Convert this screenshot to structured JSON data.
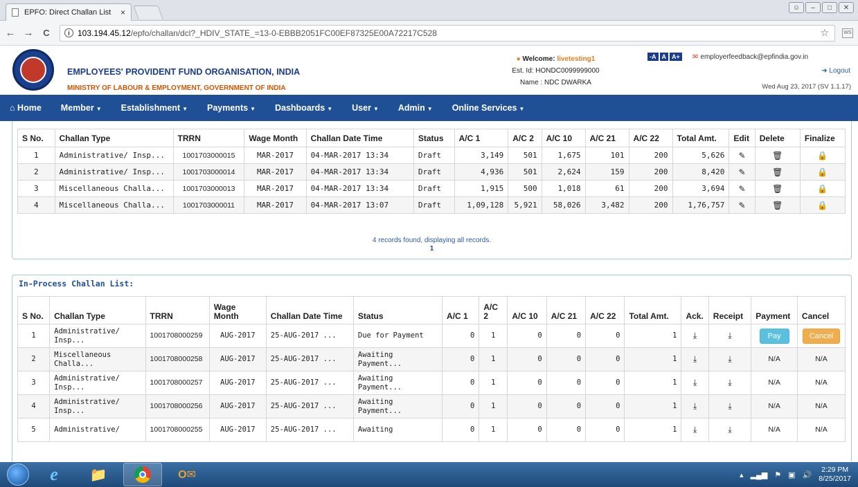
{
  "browser": {
    "tab_title": "EPFO: Direct Challan List",
    "tab_close": "×",
    "url_host": "103.194.45.12",
    "url_path": "/epfo/challan/dcl?_HDIV_STATE_=13-0-EBBB2051FC00EF87325E00A72217C528",
    "info_glyph": "i",
    "star_glyph": "☆",
    "back_glyph": "←",
    "forward_glyph": "→",
    "reload_glyph": "C"
  },
  "header": {
    "org_name": "EMPLOYEES' PROVIDENT FUND ORGANISATION, INDIA",
    "ministry": "MINISTRY OF LABOUR & EMPLOYMENT, GOVERNMENT OF INDIA",
    "welcome_label": "Welcome: ",
    "welcome_user": "livetesting1",
    "est_id": "Est. Id: HONDC0099999000",
    "name": "Name : NDC DWARKA",
    "font_small": "-A",
    "font_normal": "A",
    "font_large": "A+",
    "feedback_email": "employerfeedback@epfindia.gov.in",
    "logout": "Logout",
    "date": "Wed Aug 23, 2017 (SV 1.1.17)"
  },
  "menu": [
    {
      "label": "Home"
    },
    {
      "label": "Member"
    },
    {
      "label": "Establishment"
    },
    {
      "label": "Payments"
    },
    {
      "label": "Dashboards"
    },
    {
      "label": "User"
    },
    {
      "label": "Admin"
    },
    {
      "label": "Online Services"
    }
  ],
  "draft_table": {
    "headers": [
      "S No.",
      "Challan Type",
      "TRRN",
      "Wage Month",
      "Challan Date Time",
      "Status",
      "A/C 1",
      "A/C 2",
      "A/C 10",
      "A/C 21",
      "A/C 22",
      "Total Amt.",
      "Edit",
      "Delete",
      "Finalize"
    ],
    "rows": [
      [
        "1",
        "Administrative/ Insp...",
        "1001703000015",
        "MAR-2017",
        "04-MAR-2017 13:34",
        "Draft",
        "3,149",
        "501",
        "1,675",
        "101",
        "200",
        "5,626"
      ],
      [
        "2",
        "Administrative/ Insp...",
        "1001703000014",
        "MAR-2017",
        "04-MAR-2017 13:34",
        "Draft",
        "4,936",
        "501",
        "2,624",
        "159",
        "200",
        "8,420"
      ],
      [
        "3",
        "Miscellaneous Challa...",
        "1001703000013",
        "MAR-2017",
        "04-MAR-2017 13:34",
        "Draft",
        "1,915",
        "500",
        "1,018",
        "61",
        "200",
        "3,694"
      ],
      [
        "4",
        "Miscellaneous Challa...",
        "1001703000011",
        "MAR-2017",
        "04-MAR-2017 13:07",
        "Draft",
        "1,09,128",
        "5,921",
        "58,026",
        "3,482",
        "200",
        "1,76,757"
      ]
    ],
    "records_text": "4 records found, displaying all records.",
    "page": "1"
  },
  "inprocess": {
    "title": "In-Process Challan List:",
    "headers": [
      "S No.",
      "Challan Type",
      "TRRN",
      "Wage Month",
      "Challan Date Time",
      "Status",
      "A/C 1",
      "A/C 2",
      "A/C 10",
      "A/C 21",
      "A/C 22",
      "Total Amt.",
      "Ack.",
      "Receipt",
      "Payment",
      "Cancel"
    ],
    "rows": [
      [
        "1",
        "Administrative/ Insp...",
        "1001708000259",
        "AUG-2017",
        "25-AUG-2017 ...",
        "Due for Payment",
        "0",
        "1",
        "0",
        "0",
        "0",
        "1",
        "Pay",
        "Cancel"
      ],
      [
        "2",
        "Miscellaneous Challa...",
        "1001708000258",
        "AUG-2017",
        "25-AUG-2017 ...",
        "Awaiting Payment...",
        "0",
        "1",
        "0",
        "0",
        "0",
        "1",
        "N/A",
        "N/A"
      ],
      [
        "3",
        "Administrative/ Insp...",
        "1001708000257",
        "AUG-2017",
        "25-AUG-2017 ...",
        "Awaiting Payment...",
        "0",
        "1",
        "0",
        "0",
        "0",
        "1",
        "N/A",
        "N/A"
      ],
      [
        "4",
        "Administrative/ Insp...",
        "1001708000256",
        "AUG-2017",
        "25-AUG-2017 ...",
        "Awaiting Payment...",
        "0",
        "1",
        "0",
        "0",
        "0",
        "1",
        "N/A",
        "N/A"
      ],
      [
        "5",
        "Administrative/",
        "1001708000255",
        "AUG-2017",
        "25-AUG-2017 ...",
        "Awaiting",
        "0",
        "1",
        "0",
        "0",
        "0",
        "1",
        "N/A",
        "N/A"
      ]
    ]
  },
  "taskbar": {
    "time": "2:29 PM",
    "date": "8/25/2017"
  },
  "icons": {
    "edit": "edit-icon",
    "delete": "trash-icon",
    "finalize": "lock-icon",
    "download": "download-icon"
  }
}
